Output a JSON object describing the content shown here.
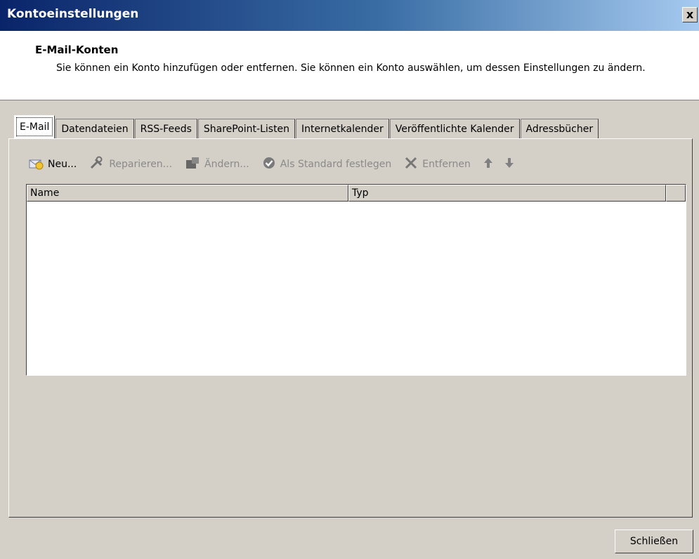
{
  "window": {
    "title": "Kontoeinstellungen",
    "close_glyph": "x"
  },
  "header": {
    "title": "E-Mail-Konten",
    "description": "Sie können ein Konto hinzufügen oder entfernen. Sie können ein Konto auswählen, um dessen Einstellungen zu ändern."
  },
  "tabs": [
    {
      "label": "E-Mail"
    },
    {
      "label": "Datendateien"
    },
    {
      "label": "RSS-Feeds"
    },
    {
      "label": "SharePoint-Listen"
    },
    {
      "label": "Internetkalender"
    },
    {
      "label": "Veröffentlichte Kalender"
    },
    {
      "label": "Adressbücher"
    }
  ],
  "toolbar": {
    "new_label": "Neu...",
    "repair_label": "Reparieren...",
    "change_label": "Ändern...",
    "set_default_label": "Als Standard festlegen",
    "remove_label": "Entfernen",
    "move_up_icon": "up-arrow-icon",
    "move_down_icon": "down-arrow-icon"
  },
  "list": {
    "columns": [
      "Name",
      "Typ"
    ],
    "rows": []
  },
  "footer": {
    "close_label": "Schließen"
  }
}
